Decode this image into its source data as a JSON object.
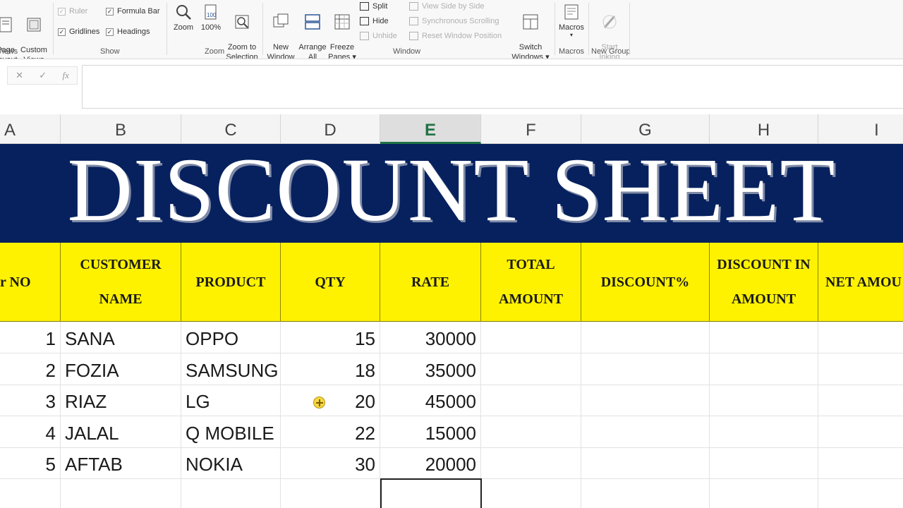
{
  "ribbon": {
    "views": {
      "page_layout": "Page\nLayout",
      "custom_views": "Custom\nViews",
      "group_label": "Views"
    },
    "show": {
      "ruler": "Ruler",
      "formula_bar": "Formula Bar",
      "gridlines": "Gridlines",
      "headings": "Headings",
      "group_label": "Show"
    },
    "zoom": {
      "zoom": "Zoom",
      "hundred": "100%",
      "zoom_to_selection": "Zoom to\nSelection",
      "group_label": "Zoom"
    },
    "window": {
      "new_window": "New\nWindow",
      "arrange_all": "Arrange\nAll",
      "freeze_panes": "Freeze\nPanes ▾",
      "split": "Split",
      "hide": "Hide",
      "unhide": "Unhide",
      "view_side_by_side": "View Side by Side",
      "synchronous_scrolling": "Synchronous Scrolling",
      "reset_window_position": "Reset Window Position",
      "switch_windows": "Switch\nWindows ▾",
      "group_label": "Window"
    },
    "macros": {
      "macros": "Macros",
      "group_label": "Macros"
    },
    "new_group": {
      "start_inking": "Start\nInking",
      "group_label": "New Group"
    }
  },
  "formula_bar": {
    "cancel": "✕",
    "enter": "✓",
    "fx": "fx",
    "value": ""
  },
  "columns": [
    "A",
    "B",
    "C",
    "D",
    "E",
    "F",
    "G",
    "H",
    "I"
  ],
  "selected_column": "E",
  "banner": {
    "title": "DISCOUNT SHEET"
  },
  "table": {
    "headers": [
      "r NO",
      "CUSTOMER\nNAME",
      "PRODUCT",
      "QTY",
      "RATE",
      "TOTAL\nAMOUNT",
      "DISCOUNT%",
      "DISCOUNT IN\nAMOUNT",
      "NET AMOU"
    ],
    "rows": [
      {
        "sr": "1",
        "name": "SANA",
        "product": "OPPO",
        "qty": "15",
        "rate": "30000"
      },
      {
        "sr": "2",
        "name": "FOZIA",
        "product": "SAMSUNG",
        "qty": "18",
        "rate": "35000"
      },
      {
        "sr": "3",
        "name": "RIAZ",
        "product": "LG",
        "qty": "20",
        "rate": "45000"
      },
      {
        "sr": "4",
        "name": "JALAL",
        "product": "Q MOBILE",
        "qty": "22",
        "rate": "15000"
      },
      {
        "sr": "5",
        "name": "AFTAB",
        "product": "NOKIA",
        "qty": "30",
        "rate": "20000"
      }
    ]
  },
  "colors": {
    "banner_bg": "#06215e",
    "header_bg": "#fff200",
    "selected_col": "#217346"
  }
}
